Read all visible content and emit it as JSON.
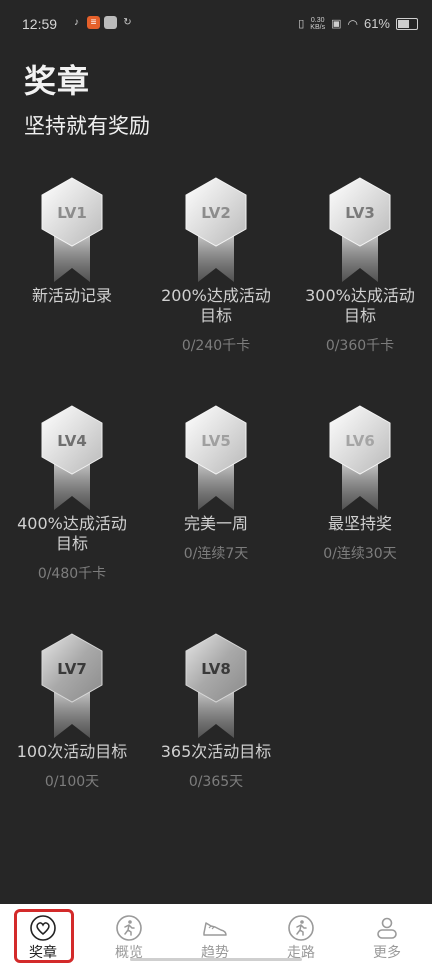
{
  "status_bar": {
    "time": "12:59",
    "speed_value": "0.30",
    "speed_unit": "KB/s",
    "battery": "61%"
  },
  "header": {
    "title": "奖章",
    "subtitle": "坚持就有奖励"
  },
  "badges": [
    {
      "level": "LV1",
      "name": "新活动记录",
      "progress": ""
    },
    {
      "level": "LV2",
      "name": "200%达成活动目标",
      "progress": "0/240千卡"
    },
    {
      "level": "LV3",
      "name": "300%达成活动目标",
      "progress": "0/360千卡"
    },
    {
      "level": "LV4",
      "name": "400%达成活动目标",
      "progress": "0/480千卡"
    },
    {
      "level": "LV5",
      "name": "完美一周",
      "progress": "0/连续7天"
    },
    {
      "level": "LV6",
      "name": "最坚持奖",
      "progress": "0/连续30天"
    },
    {
      "level": "LV7",
      "name": "100次活动目标",
      "progress": "0/100天"
    },
    {
      "level": "LV8",
      "name": "365次活动目标",
      "progress": "0/365天"
    }
  ],
  "tabs": [
    {
      "label": "奖章",
      "icon": "heart-icon",
      "active": true
    },
    {
      "label": "概览",
      "icon": "runner-icon",
      "active": false
    },
    {
      "label": "趋势",
      "icon": "shoe-icon",
      "active": false
    },
    {
      "label": "走路",
      "icon": "runner-icon",
      "active": false
    },
    {
      "label": "更多",
      "icon": "person-icon",
      "active": false
    }
  ],
  "colors": {
    "background": "#262626",
    "tab_bar": "#ffffff",
    "highlight": "#d32a2a"
  }
}
